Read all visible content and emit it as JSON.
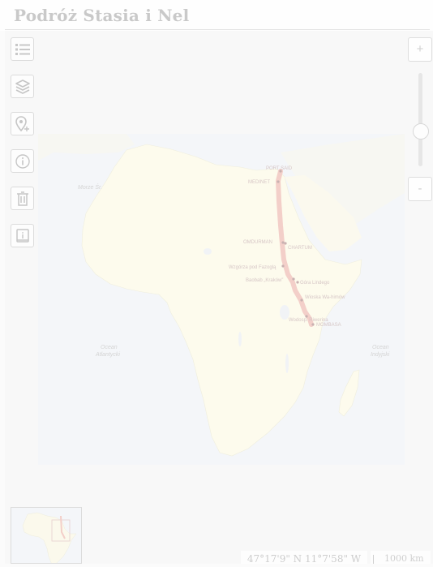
{
  "title": "Podróż Stasia i Nel",
  "toolbar": {
    "items": [
      {
        "name": "legend-list-button",
        "icon": "list-icon"
      },
      {
        "name": "layers-button",
        "icon": "layers-icon"
      },
      {
        "name": "add-marker-button",
        "icon": "add-marker-icon"
      },
      {
        "name": "info-button",
        "icon": "info-icon"
      },
      {
        "name": "delete-button",
        "icon": "trash-icon"
      },
      {
        "name": "book-button",
        "icon": "book-icon"
      }
    ]
  },
  "zoom": {
    "in_label": "+",
    "out_label": "-",
    "level": 0.36
  },
  "map": {
    "places": [
      {
        "name": "PORT SAID",
        "label": "PORT SAID"
      },
      {
        "name": "MEDINET",
        "label": "MEDINET"
      },
      {
        "name": "OMDURMAN",
        "label": "OMDURMAN"
      },
      {
        "name": "CHARTUM",
        "label": "CHARTUM"
      },
      {
        "name": "Wzgórza Fazogly",
        "label": "Wzgórza pod Fazoglą"
      },
      {
        "name": "Baobab Kraków",
        "label": "Baobab „Kraków”"
      },
      {
        "name": "Góra Lindego",
        "label": "Góra Lindego"
      },
      {
        "name": "Wioska Wa-himów",
        "label": "Wioska Wa-himów"
      },
      {
        "name": "Wodospad",
        "label": "Wodosp. Riwerina"
      },
      {
        "name": "MOMBASA",
        "label": "MOMBASA"
      }
    ],
    "other_labels": {
      "ocean_atlantic_1": "Ocean",
      "ocean_atlantic_2": "Atlantycki",
      "ocean_indian_1": "Ocean",
      "ocean_indian_2": "Indyjski",
      "sea_label": "Morze Śr."
    },
    "colors": {
      "land": "#fdfbed",
      "sea": "#f4f6f9",
      "route": "#f3cfc9",
      "dot": "#c9b1b1"
    }
  },
  "status": {
    "coordinates": "47°17'9\" N 11°7'58\" W",
    "scale": "1000 km"
  }
}
